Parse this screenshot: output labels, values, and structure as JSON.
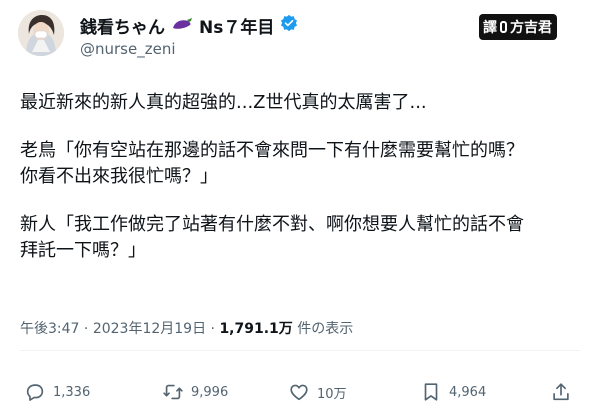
{
  "author": {
    "display_name": "銭看ちゃん",
    "display_suffix": "Ns７年目",
    "handle": "@nurse_zeni",
    "verified_icon": "verified-badge-icon",
    "emoji_icon": "eggplant-icon"
  },
  "watermark": {
    "prefix": "譯",
    "name": "方吉君"
  },
  "tweet": {
    "paragraphs": [
      "最近新來的新人真的超強的...Z世代真的太厲害了...",
      "老鳥「你有空站在那邊的話不會來問一下有什麼需要幫忙的嗎？\n你看不出來我很忙嗎？」",
      "新人「我工作做完了站著有什麼不對、啊你想要人幫忙的話不會\n拜託一下嗎？」"
    ]
  },
  "meta": {
    "time": "午後3:47",
    "sep1": "·",
    "date": "2023年12月19日",
    "sep2": "·",
    "views_count": "1,791.1万",
    "views_label": "件の表示"
  },
  "actions": {
    "reply_count": "1,336",
    "retweet_count": "9,996",
    "like_count": "10万",
    "bookmark_count": "4,964"
  },
  "colors": {
    "text": "#0f1419",
    "muted": "#536471",
    "verified": "#1d9bf0",
    "eggplant": "#6b2fa0"
  }
}
